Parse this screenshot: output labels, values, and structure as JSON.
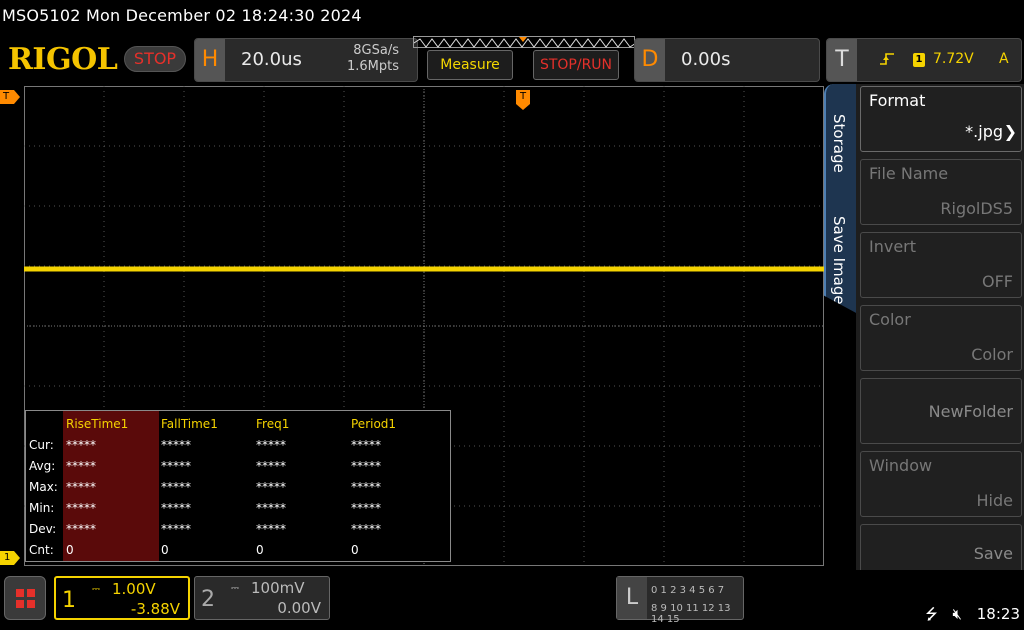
{
  "titlebar": {
    "text": "MSO5102  Mon December 02 18:24:30 2024"
  },
  "header": {
    "logo": "RIGOL",
    "run_state": "STOP",
    "horizontal": {
      "letter": "H",
      "timebase": "20.0us",
      "sample_rate": "8GSa/s",
      "memory_depth": "1.6Mpts"
    },
    "measure_label": "Measure",
    "stoprun_label": "STOP/RUN",
    "delay": {
      "letter": "D",
      "value": "0.00s"
    },
    "trigger": {
      "letter": "T",
      "edge_icon": "rising-edge-icon",
      "source": "1",
      "level": "7.72V",
      "mode": "A"
    }
  },
  "markers": {
    "trigger_left": "T",
    "trigger_top": "T",
    "ch1_left": "1"
  },
  "measure": {
    "columns": [
      "RiseTime1",
      "FallTime1",
      "Freq1",
      "Period1"
    ],
    "rows": [
      {
        "label": "Cur:",
        "values": [
          "*****",
          "*****",
          "*****",
          "*****"
        ]
      },
      {
        "label": "Avg:",
        "values": [
          "*****",
          "*****",
          "*****",
          "*****"
        ]
      },
      {
        "label": "Max:",
        "values": [
          "*****",
          "*****",
          "*****",
          "*****"
        ]
      },
      {
        "label": "Min:",
        "values": [
          "*****",
          "*****",
          "*****",
          "*****"
        ]
      },
      {
        "label": "Dev:",
        "values": [
          "*****",
          "*****",
          "*****",
          "*****"
        ]
      },
      {
        "label": "Cnt:",
        "values": [
          "0",
          "0",
          "0",
          "0"
        ]
      }
    ]
  },
  "side_tabs": [
    "Storage",
    "Save Image"
  ],
  "side_menu": [
    {
      "title": "Format",
      "value": "*.jpg",
      "state": "active",
      "has_arrow": true
    },
    {
      "title": "File Name",
      "value": "RigolDS5",
      "state": "disabled"
    },
    {
      "title": "Invert",
      "value": "OFF",
      "state": "disabled"
    },
    {
      "title": "Color",
      "value": "Color",
      "state": "disabled"
    },
    {
      "title": "",
      "value": "NewFolder",
      "state": "plain"
    },
    {
      "title": "Window",
      "value": "Hide",
      "state": "disabled"
    },
    {
      "title": "",
      "value": "Save",
      "state": "plain"
    }
  ],
  "channels": {
    "ch1": {
      "num": "1",
      "scale": "1.00V",
      "offset": "-3.88V",
      "coupling_icon": "dc-coupling-icon"
    },
    "ch2": {
      "num": "2",
      "scale": "100mV",
      "offset": "0.00V",
      "coupling_icon": "dc-coupling-icon"
    }
  },
  "logic": {
    "letter": "L",
    "row1": "0 1 2 3   4 5 6 7",
    "row2": "8 9 10 11  12 13 14 15"
  },
  "status": {
    "usb_icon": "usb-icon",
    "sound_icon": "mute-icon",
    "time": "18:23"
  },
  "colors": {
    "ch1": "#f5d300",
    "accent": "#ff8a00",
    "stop": "#e5302a",
    "tab": "#1e3550"
  },
  "waveform": {
    "ch1_level_div": 3.05
  }
}
